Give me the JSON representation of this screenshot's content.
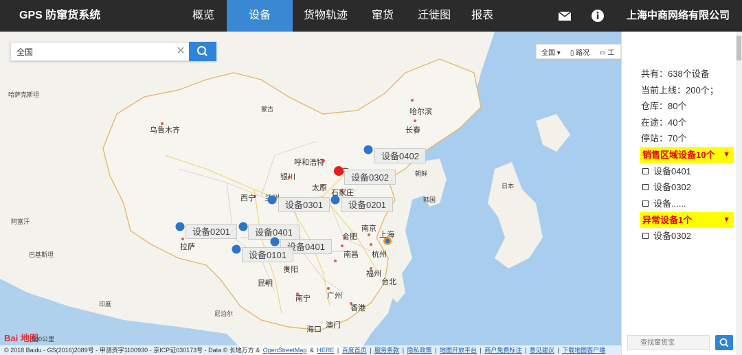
{
  "header": {
    "app_title": "GPS 防窜货系统",
    "nav": [
      "概览",
      "设备",
      "货物轨迹",
      "窜货",
      "迁徙图",
      "报表"
    ],
    "company": "上海中商网络有限公司"
  },
  "search": {
    "value": "全国"
  },
  "map_tools": {
    "region": "全国",
    "traffic": "路况",
    "tools": "工"
  },
  "map_places": {
    "hakeke": "哈萨克斯坦",
    "mongolia": "蒙古",
    "harbin": "哈尔滨",
    "changchun": "长春",
    "urumqi": "乌鲁木齐",
    "hohhot": "呼和浩特",
    "yinchuan": "银川",
    "taiyuan": "太原",
    "shijiazhuang": "石家庄",
    "xining": "西宁",
    "lanzhou": "兰州",
    "korea_n": "朝鲜",
    "korea_s": "韩国",
    "japan": "日本",
    "afghan": "阿富汗",
    "pakistan": "巴基斯坦",
    "lhasa": "拉萨",
    "nanjing": "南京",
    "hefei": "合肥",
    "shanghai": "上海",
    "wuhan": "武汉",
    "changsha": "长沙",
    "nanchang": "南昌",
    "hangzhou": "杭州",
    "guiyang": "贵阳",
    "fuzhou": "福州",
    "taipei": "台北",
    "kunming": "昆明",
    "nanning": "南宁",
    "guangzhou": "广州",
    "hongkong": "香港",
    "macau": "澳门",
    "haikou": "海口",
    "india": "印度",
    "nepal": "尼泊尔",
    "beijing": "北京"
  },
  "device_labels": [
    "设备0402",
    "设备0302",
    "设备0301",
    "设备0201",
    "设备0201",
    "设备0401",
    "设备0401",
    "设备0101"
  ],
  "map_footer": {
    "copyright": "© 2018 Baidu - GS(2016)2089号 - 甲测资字1100930 - 京ICP证030173号 - Data © 长地万方 &",
    "links": [
      "OpenStreetMap",
      "&",
      "HERE",
      "|",
      "百度首页",
      "|",
      "服务条款",
      "|",
      "隐私政策",
      "|",
      "地图开放平台",
      "|",
      "商户免费标注",
      "|",
      "意见建议",
      "|",
      "下载地图客户端"
    ],
    "scale": "500公里",
    "logo": "Bai 地图"
  },
  "stats": {
    "total": "共有：638个设备",
    "online": "当前上线：200个；",
    "warehouse": "仓库：80个",
    "transit": "在途：40个",
    "stopped": "停站：70个"
  },
  "groups": {
    "sales": {
      "title": "销售区域设备10个",
      "items": [
        "设备0401",
        "设备0302",
        "设备......"
      ]
    },
    "abnormal": {
      "title": "异常设备1个",
      "items": [
        "设备0302"
      ]
    }
  },
  "panel_search_placeholder": "查找窜货宝",
  "colors": {
    "accent": "#3a88d4",
    "alert": "#e60012",
    "highlight": "#ffff00",
    "marker": "#2e75c8",
    "marker_alert": "#e81c1c"
  }
}
